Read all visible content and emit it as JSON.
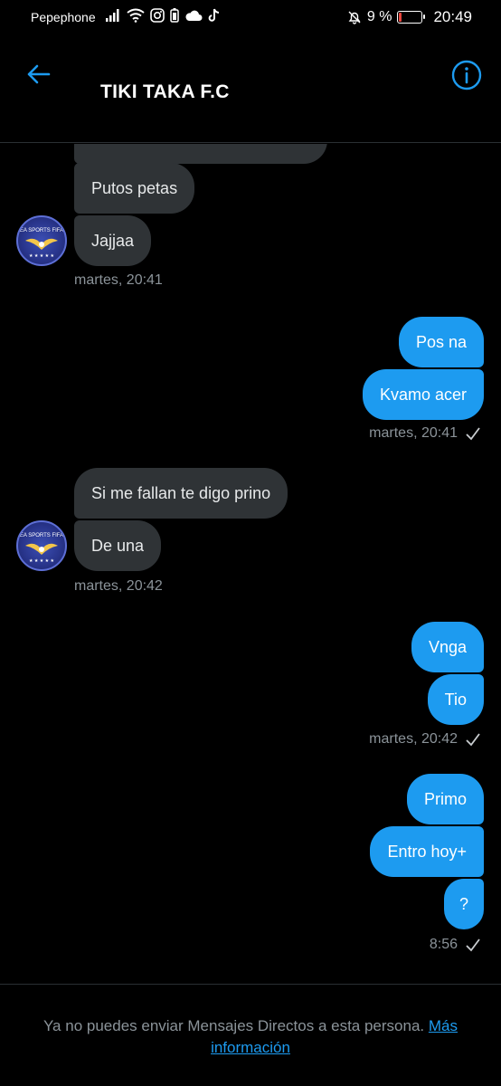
{
  "status_bar": {
    "carrier": "Pepephone",
    "battery_percent": "9 %",
    "time": "20:49",
    "icons_left": [
      "signal-icon",
      "wifi-icon",
      "instagram-icon",
      "battery-saver-icon",
      "cloud-icon",
      "tiktok-icon"
    ],
    "icons_right": [
      "mute-bell-icon",
      "battery-icon"
    ]
  },
  "header": {
    "title": "TIKI TAKA F.C",
    "back_icon": "arrow-left-icon",
    "info_icon": "info-circle-icon"
  },
  "conversation": {
    "group1_partial": "",
    "group1_msg1": "Putos petas",
    "group1_msg2": "Jajjaa",
    "group1_time": "martes, 20:41",
    "group2_msg1": "Pos na",
    "group2_msg2": "Kvamo acer",
    "group2_time": "martes, 20:41",
    "group3_msg1": "Si me fallan te digo prino",
    "group3_msg2": "De una",
    "group3_time": "martes, 20:42",
    "group4_msg1": "Vnga",
    "group4_msg2": "Tio",
    "group4_time": "martes, 20:42",
    "group5_msg1": "Primo",
    "group5_msg2": "Entro hoy+",
    "group5_msg3": "?",
    "group5_time": "8:56"
  },
  "footer": {
    "notice": "Ya no puedes enviar Mensajes Directos a esta persona.",
    "link_part1": "Más",
    "link_part2": "información"
  },
  "colors": {
    "accent": "#1d9bf0",
    "incoming_bubble": "#2f3336",
    "background": "#000000",
    "muted_text": "#8b9399"
  }
}
